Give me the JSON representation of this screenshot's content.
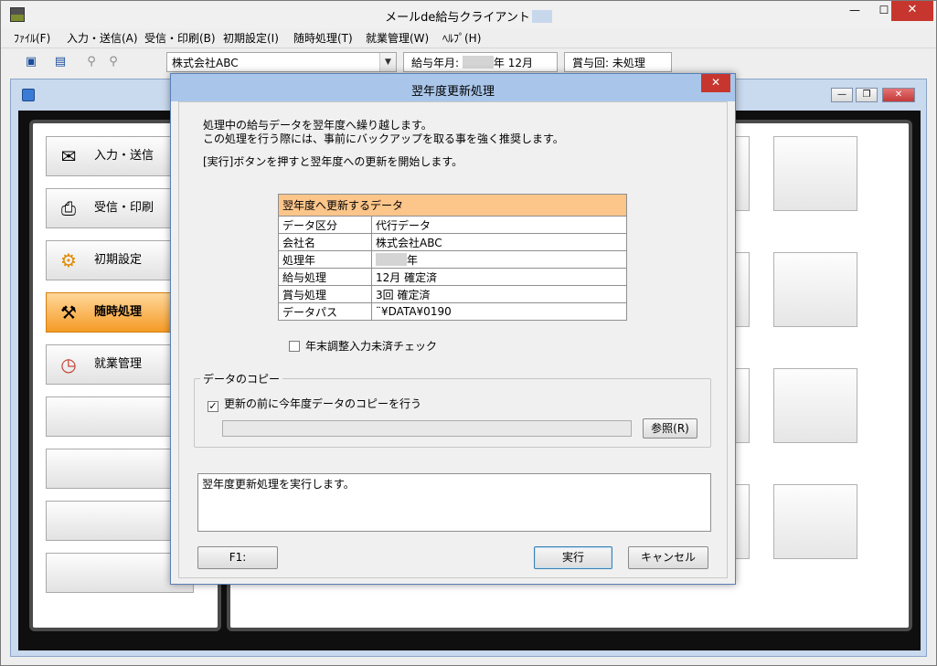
{
  "window": {
    "title": "メールde給与クライアント",
    "close_icon": "close-icon",
    "min_icon": "minimize-icon",
    "max_icon": "maximize-icon"
  },
  "menu": [
    {
      "label": "ﾌｧｲﾙ(F)"
    },
    {
      "label": "入力・送信(A)"
    },
    {
      "label": "受信・印刷(B)"
    },
    {
      "label": "初期設定(I)"
    },
    {
      "label": "随時処理(T)"
    },
    {
      "label": "就業管理(W)"
    },
    {
      "label": "ﾍﾙﾌﾟ(H)"
    }
  ],
  "toolbar": {
    "company_select": "株式会社ABC",
    "salary_label": "給与年月:",
    "salary_month": "年 12月",
    "bonus_label": "賞与回:",
    "bonus_value": "未処理"
  },
  "sidebar": {
    "items": [
      {
        "label": "入力・送信",
        "icon": "envelope-icon"
      },
      {
        "label": "受信・印刷",
        "icon": "printer-icon"
      },
      {
        "label": "初期設定",
        "icon": "gear-icon"
      },
      {
        "label": "随時処理",
        "icon": "tools-icon",
        "active": true
      },
      {
        "label": "就業管理",
        "icon": "clock-icon"
      }
    ]
  },
  "dialog": {
    "title": "翌年度更新処理",
    "message_line1": "処理中の給与データを翌年度へ繰り越します。",
    "message_line2": "この処理を行う際には、事前にバックアップを取る事を強く推奨します。",
    "message_line3": "[実行]ボタンを押すと翌年度への更新を開始します。",
    "table": {
      "header": "翌年度へ更新するデータ",
      "rows": [
        {
          "key": "データ区分",
          "value": "代行データ"
        },
        {
          "key": "会社名",
          "value": "株式会社ABC"
        },
        {
          "key": "処理年",
          "value": "年"
        },
        {
          "key": "給与処理",
          "value": "12月 確定済"
        },
        {
          "key": "賞与処理",
          "value": " 3回 確定済"
        },
        {
          "key": "データパス",
          "value": "¨¥DATA¥0190"
        }
      ]
    },
    "year_end_check_label": "年末調整入力未済チェック",
    "year_end_check_checked": false,
    "copy_group_label": "データのコピー",
    "copy_check_label": "更新の前に今年度データのコピーを行う",
    "copy_check_checked": true,
    "copy_path": "",
    "browse_button": "参照(R)",
    "status_text": "翌年度更新処理を実行します。",
    "f1_button": "F1:",
    "run_button": "実行",
    "cancel_button": "キャンセル"
  }
}
